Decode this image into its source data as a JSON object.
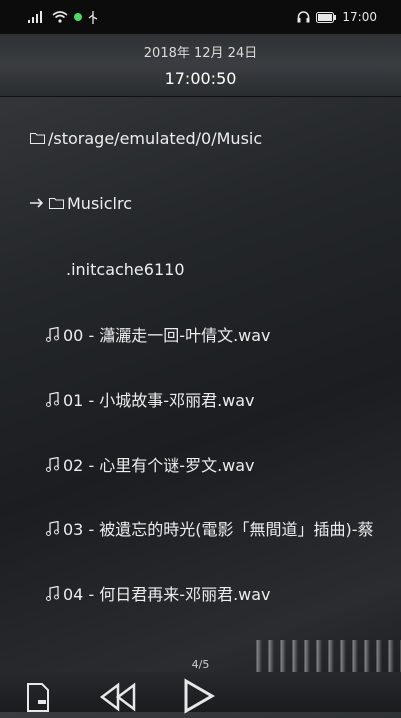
{
  "status_bar": {
    "signal": "⁴⁶ᵍ",
    "time": "17:00",
    "icons": [
      "signal-icon",
      "wifi-icon",
      "green-dot-icon",
      "usb-icon",
      "headphones-icon",
      "battery-icon"
    ]
  },
  "header": {
    "date": "2018年 12月 24日",
    "time": "17:00:50"
  },
  "file_list": {
    "items": [
      {
        "label": "/storage/emulated/0/Music",
        "icon": "folder-icon"
      },
      {
        "label": "Musiclrc",
        "icon": "folder-icon",
        "prefix_icon": "arrow-right-icon"
      },
      {
        "label": ".initcache6110",
        "icon": ""
      },
      {
        "label": "00 - 瀟灑走一回-叶倩文.wav",
        "icon": "music-note-icon"
      },
      {
        "label": "01 - 小城故事-邓丽君.wav",
        "icon": "music-note-icon"
      },
      {
        "label": "02 - 心里有个谜-罗文.wav",
        "icon": "music-note-icon"
      },
      {
        "label": "03 - 被遺忘的時光(電影「無間道」插曲)-蔡",
        "icon": "music-note-icon"
      },
      {
        "label": "04 - 何日君再来-邓丽君.wav",
        "icon": "music-note-icon"
      }
    ]
  },
  "page_indicator": "4/5",
  "controls": [
    "sdcard-icon",
    "rewind-icon",
    "play-icon"
  ],
  "colors": {
    "status_bg": "#0c0c0c",
    "accent_green": "#4cd964",
    "text": "#ededed"
  }
}
